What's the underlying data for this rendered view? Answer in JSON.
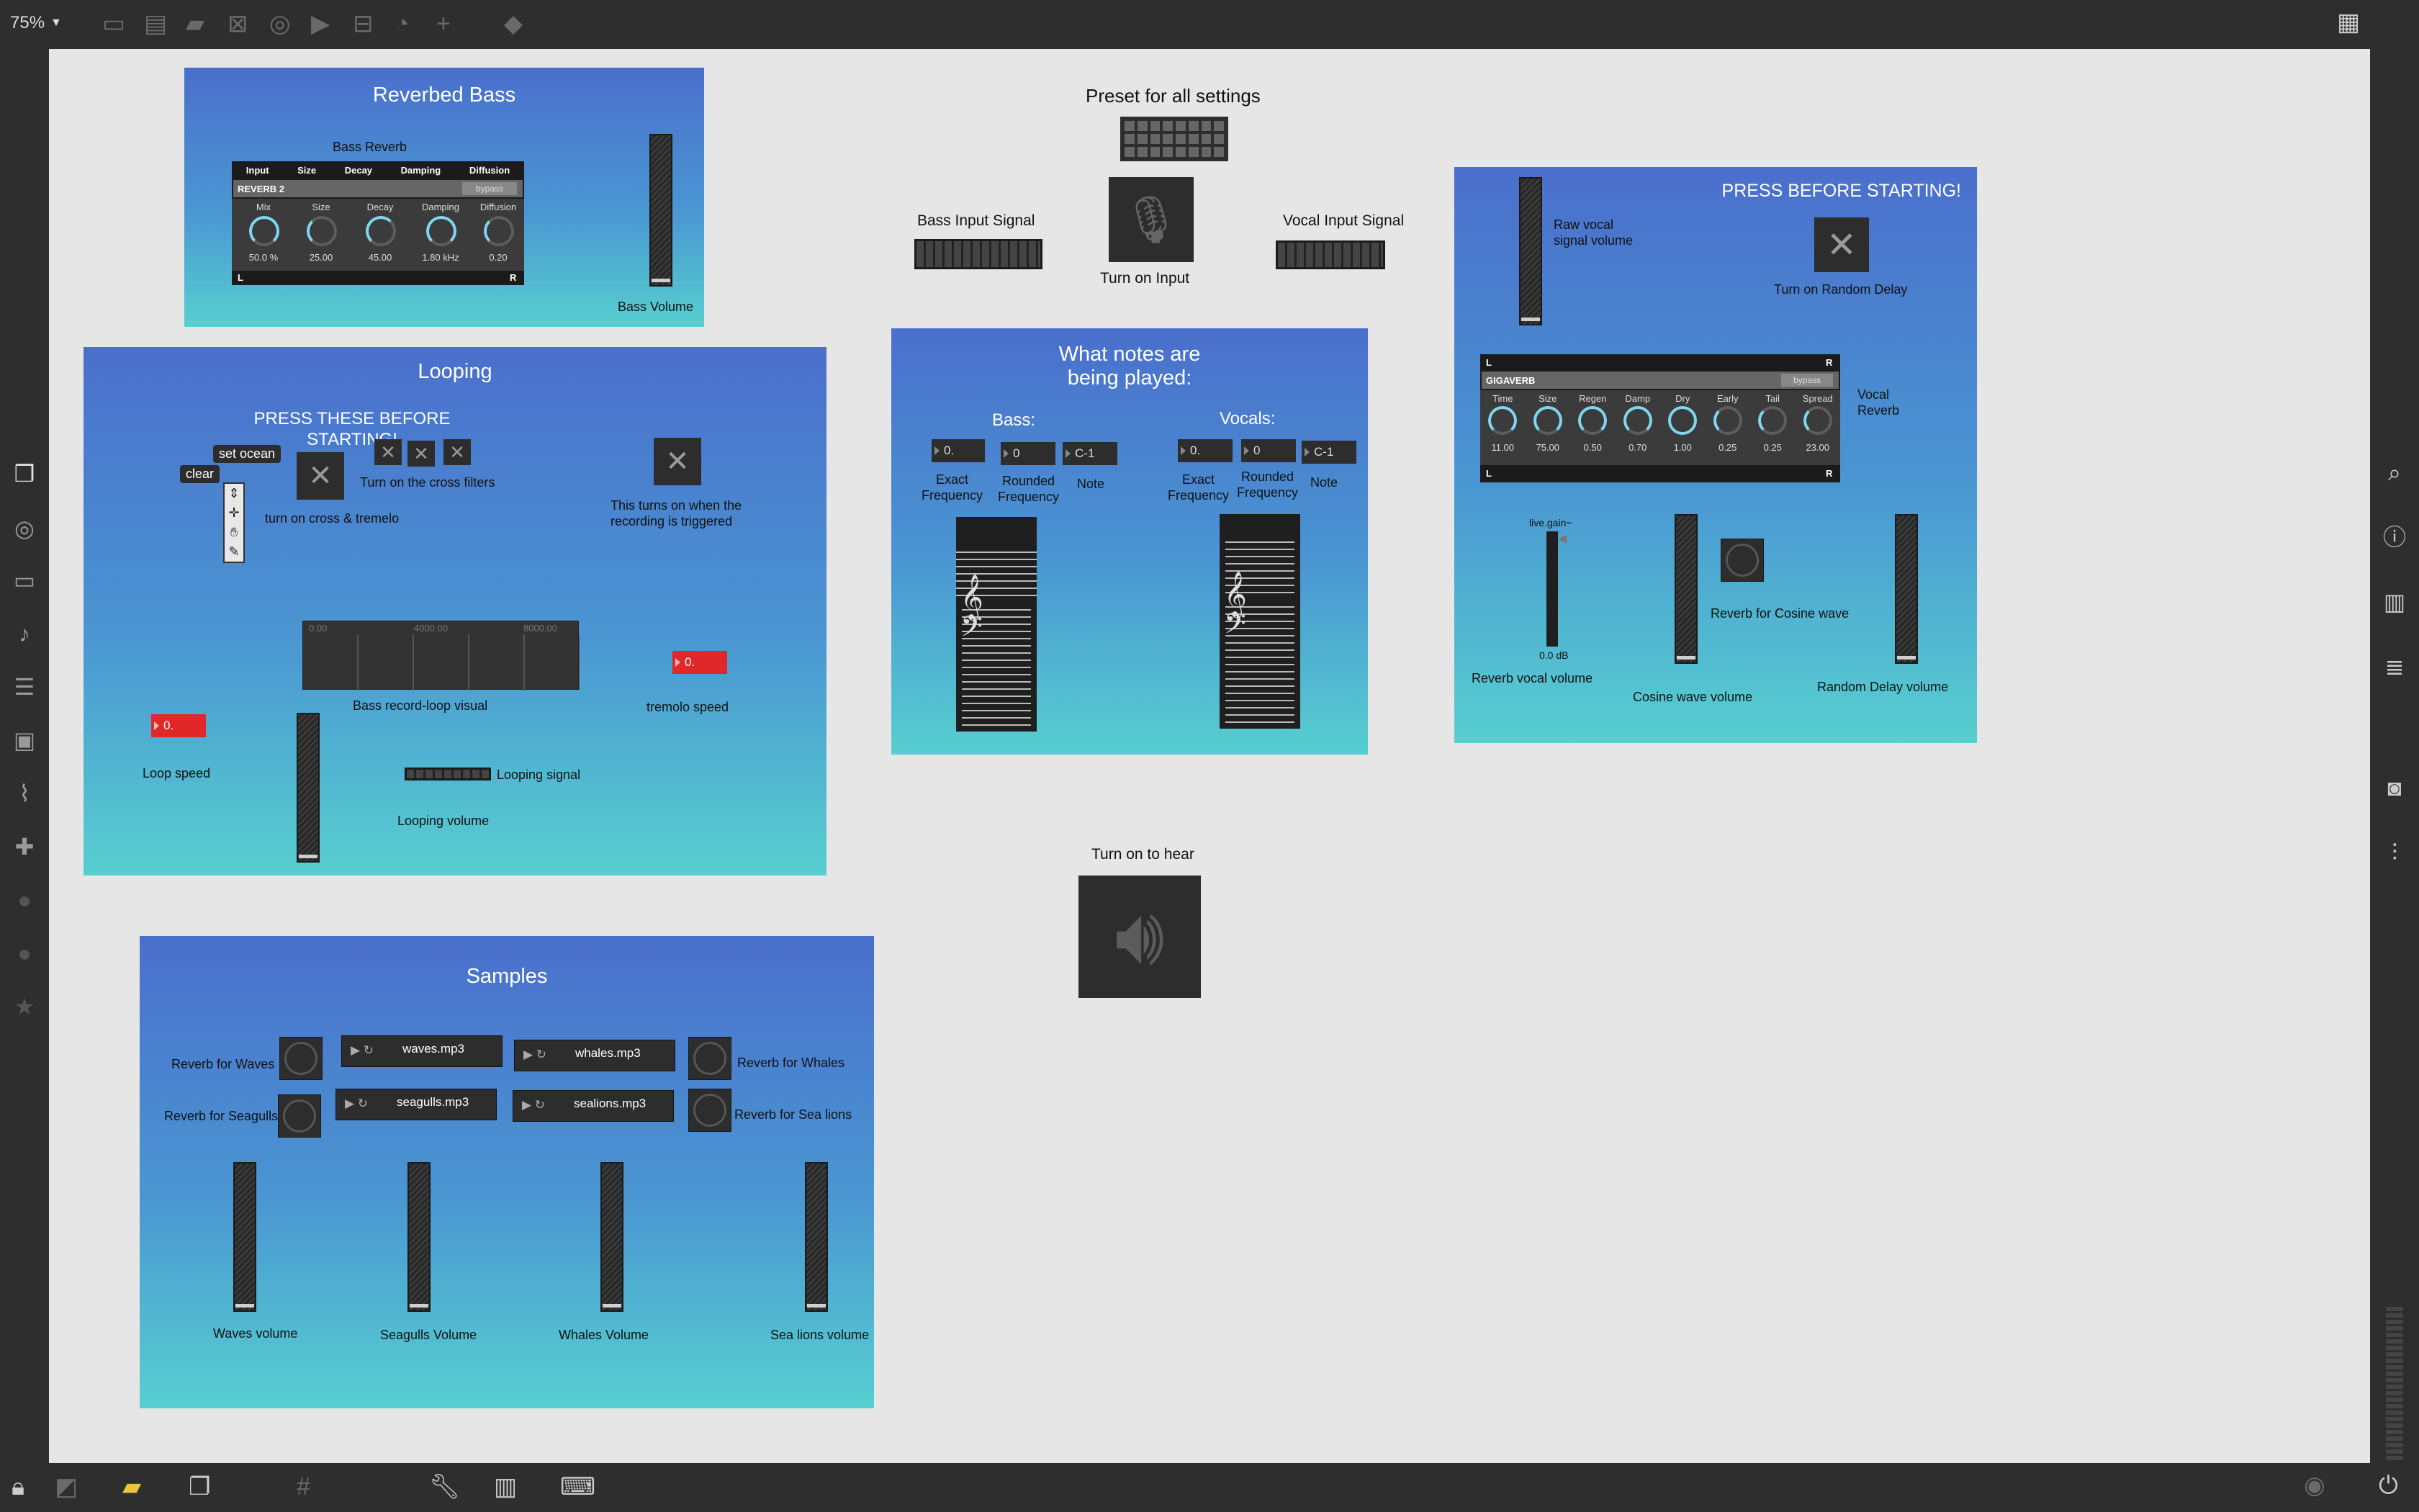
{
  "toolbar": {
    "zoom": "75%"
  },
  "canvas": {
    "bass_panel": {
      "title": "Reverbed Bass",
      "reverb_label": "Bass Reverb",
      "header_cols": [
        "Input",
        "Size",
        "Decay",
        "Damping",
        "Diffusion"
      ],
      "device_name": "REVERB 2",
      "bypass": "bypass",
      "knobs": [
        {
          "name": "Mix",
          "value": "50.0 %"
        },
        {
          "name": "Size",
          "value": "25.00"
        },
        {
          "name": "Decay",
          "value": "45.00"
        },
        {
          "name": "Damping",
          "value": "1.80 kHz"
        },
        {
          "name": "Diffusion",
          "value": "0.20"
        }
      ],
      "left": "L",
      "right": "R",
      "volume_label": "Bass Volume"
    },
    "looping_panel": {
      "title": "Looping",
      "press_label": "PRESS THESE BEFORE\nSTARTING!",
      "set_ocean": "set ocean",
      "clear": "clear",
      "cross_filters_label": "Turn on the cross filters",
      "cross_tremelo_label": "turn on cross & tremelo",
      "record_trigger_label": "This turns on when the\nrecording is triggered",
      "waveform_ticks": [
        "0.00",
        "4000.00",
        "8000.00"
      ],
      "waveform_label": "Bass record-loop visual",
      "tremolo_value": "0.",
      "tremolo_label": "tremolo speed",
      "loop_value": "0.",
      "loop_label": "Loop speed",
      "looping_signal_label": "Looping signal",
      "looping_volume_label": "Looping volume"
    },
    "preset": {
      "label": "Preset for all settings"
    },
    "inputs": {
      "bass_label": "Bass Input Signal",
      "mic_label": "Turn on Input",
      "vocal_label": "Vocal Input Signal"
    },
    "notes_panel": {
      "title": "What notes are\nbeing played:",
      "bass_title": "Bass:",
      "vocals_title": "Vocals:",
      "bass_values": [
        "0.",
        "0",
        "C-1"
      ],
      "vocal_values": [
        "0.",
        "0",
        "C-1"
      ],
      "col_labels": [
        "Exact\nFrequency",
        "Rounded\nFrequency",
        "Note"
      ]
    },
    "speaker": {
      "label": "Turn on to hear"
    },
    "vocal_panel": {
      "press_label": "PRESS BEFORE STARTING!",
      "raw_label": "Raw vocal\nsignal volume",
      "random_delay_label": "Turn on Random Delay",
      "device_name": "GIGAVERB",
      "bypass": "bypass",
      "left": "L",
      "right": "R",
      "knobs": [
        {
          "name": "Time",
          "value": "11.00"
        },
        {
          "name": "Size",
          "value": "75.00"
        },
        {
          "name": "Regen",
          "value": "0.50"
        },
        {
          "name": "Damp",
          "value": "0.70"
        },
        {
          "name": "Dry",
          "value": "1.00"
        },
        {
          "name": "Early",
          "value": "0.25"
        },
        {
          "name": "Tail",
          "value": "0.25"
        },
        {
          "name": "Spread",
          "value": "23.00"
        }
      ],
      "vocal_reverb_label": "Vocal\nReverb",
      "gain_label": "live.gain~",
      "gain_value": "0.0 dB",
      "reverb_vocal_label": "Reverb vocal volume",
      "cosine_reverb_label": "Reverb for Cosine wave",
      "cosine_volume_label": "Cosine wave volume",
      "random_delay_volume_label": "Random Delay volume"
    },
    "samples_panel": {
      "title": "Samples",
      "reverb_waves": "Reverb for Waves",
      "reverb_seagulls": "Reverb for Seagulls",
      "reverb_whales": "Reverb for Whales",
      "reverb_sealions": "Reverb for Sea lions",
      "files": [
        "waves.mp3",
        "whales.mp3",
        "seagulls.mp3",
        "sealions.mp3"
      ],
      "volumes": [
        "Waves volume",
        "Seagulls Volume",
        "Whales Volume",
        "Sea lions volume"
      ]
    }
  }
}
